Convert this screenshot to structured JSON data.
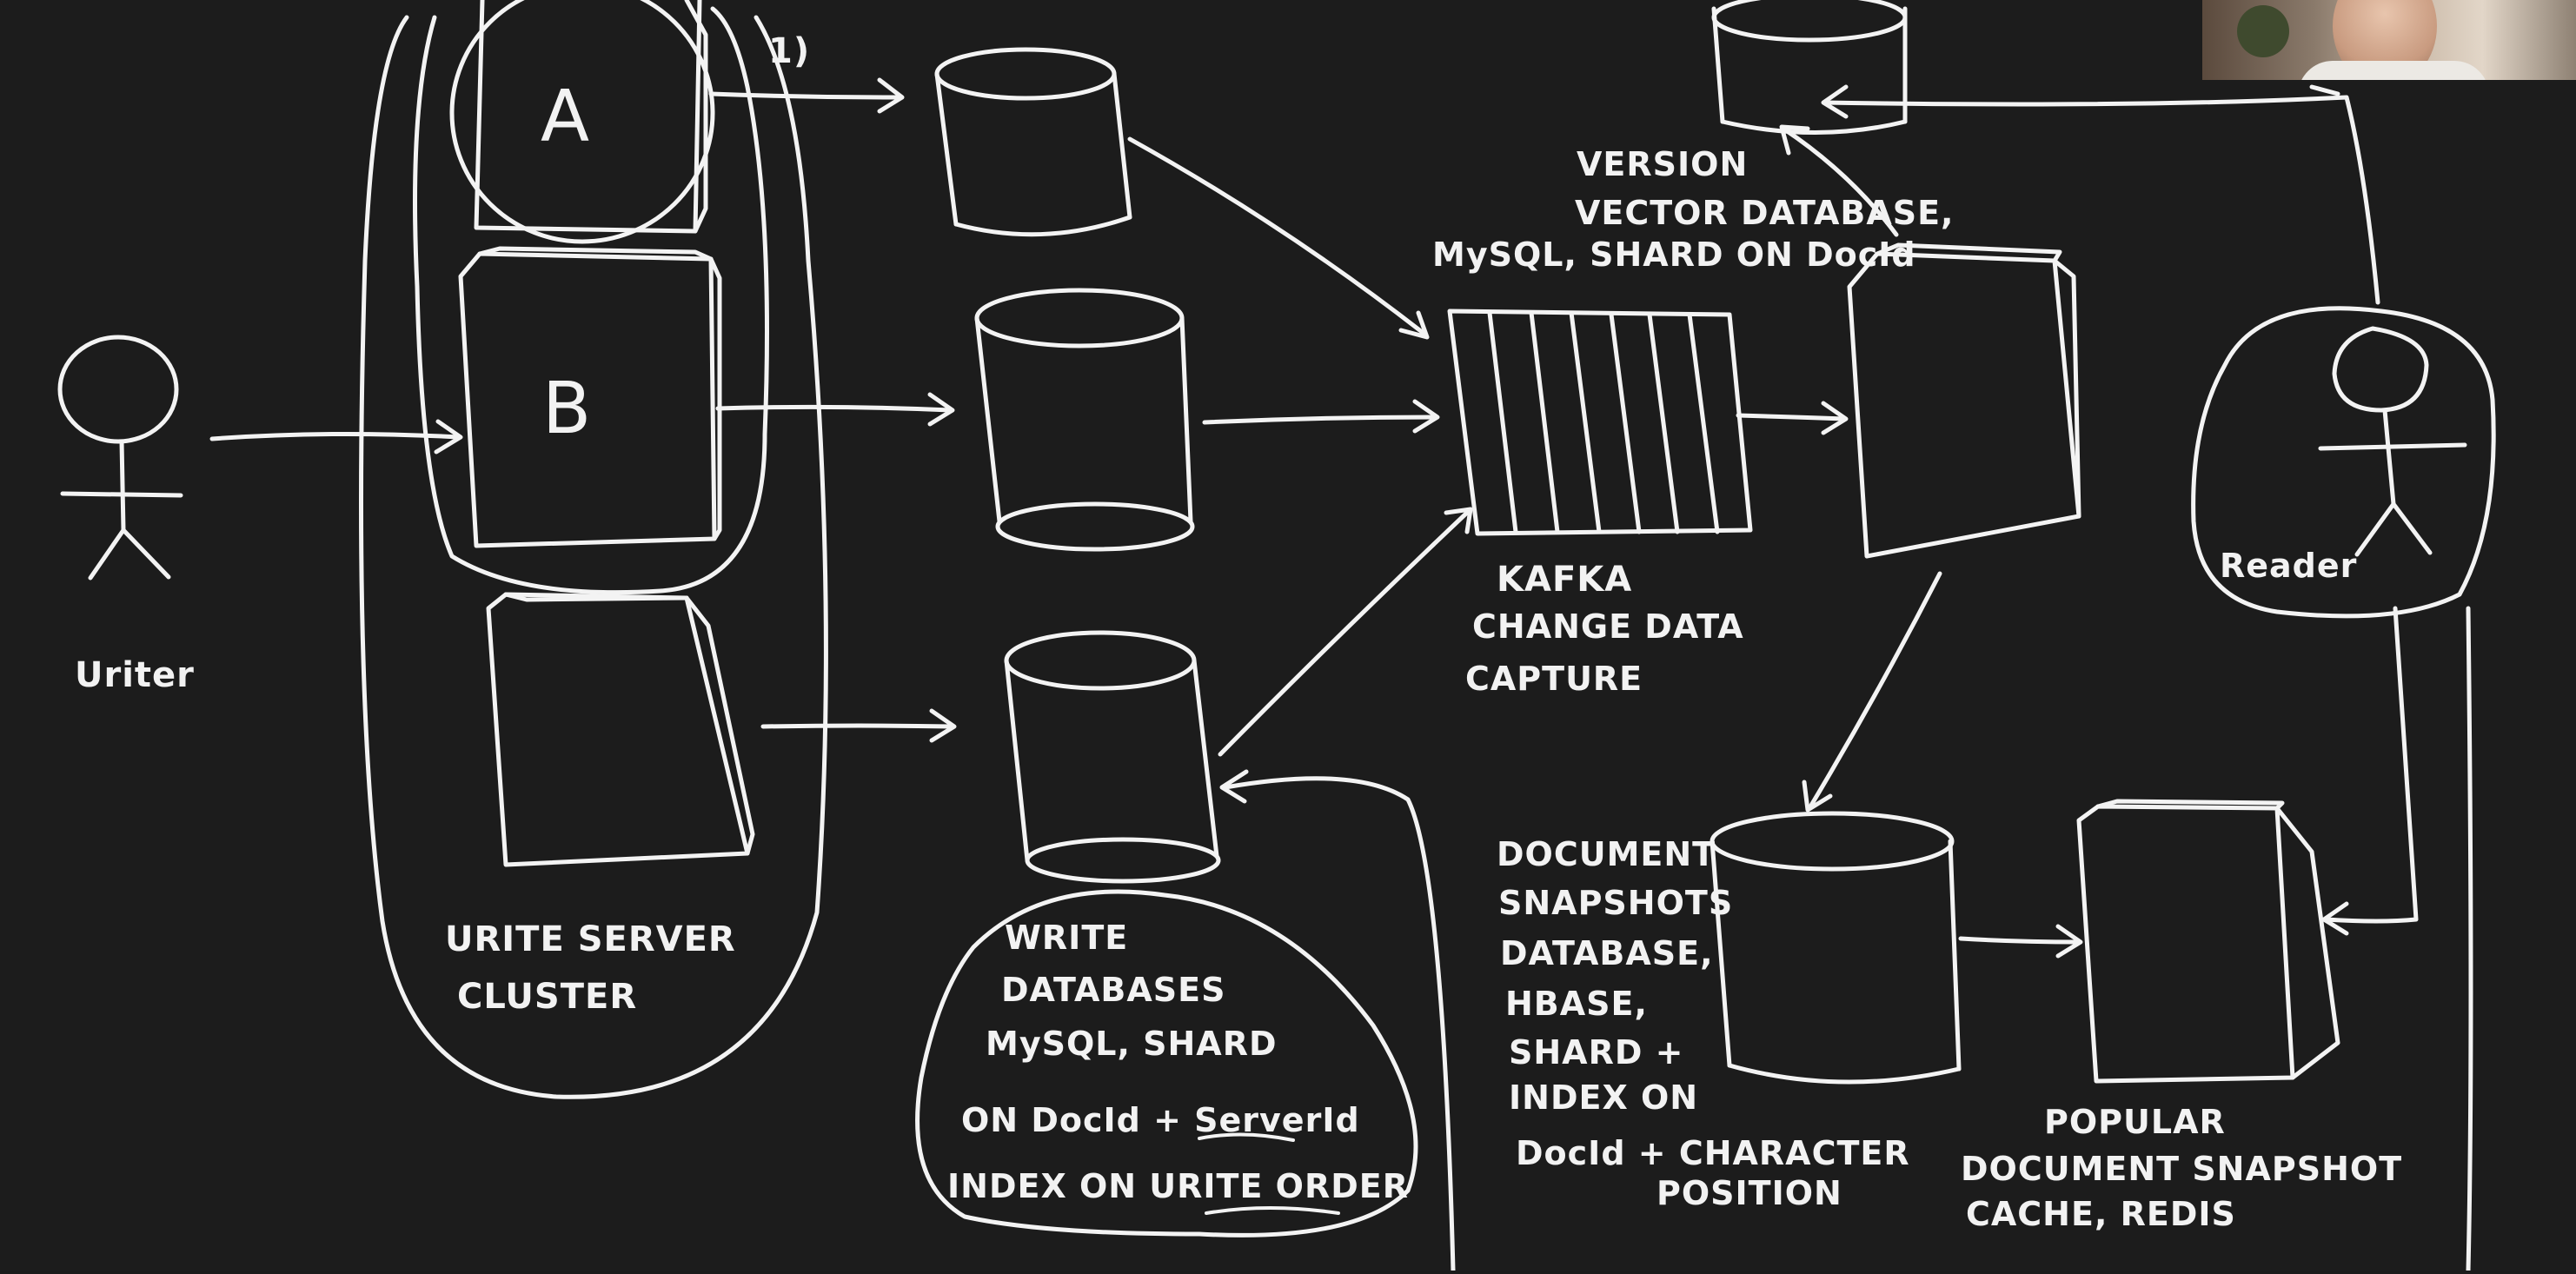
{
  "labels": {
    "step": "1)",
    "server_a": "A",
    "server_b": "B",
    "writer": "Uriter",
    "reader": "Reader",
    "write_server_cluster": [
      "URITE SERVER",
      "CLUSTER"
    ],
    "write_databases": [
      "WRITE",
      "DATABASES",
      "MySQL, SHARD",
      "ON DocId + ServerId",
      "INDEX ON URITE ORDER"
    ],
    "kafka": [
      "KAFKA",
      "CHANGE DATA",
      "CAPTURE"
    ],
    "version_vector_db": [
      "VERSION",
      "VECTOR DATABASE,",
      "MySQL, SHARD ON DocId"
    ],
    "document_snapshots_db": [
      "DOCUMENT",
      "SNAPSHOTS",
      "DATABASE,",
      "HBASE,",
      "SHARD +",
      "INDEX ON",
      "DocId + CHARACTER",
      "POSITION"
    ],
    "popular_snapshot_cache": [
      "POPULAR",
      "DOCUMENT SNAPSHOT",
      "CACHE, REDIS"
    ]
  },
  "colors": {
    "background": "#1c1c1c",
    "ink": "#f3f3f3"
  }
}
